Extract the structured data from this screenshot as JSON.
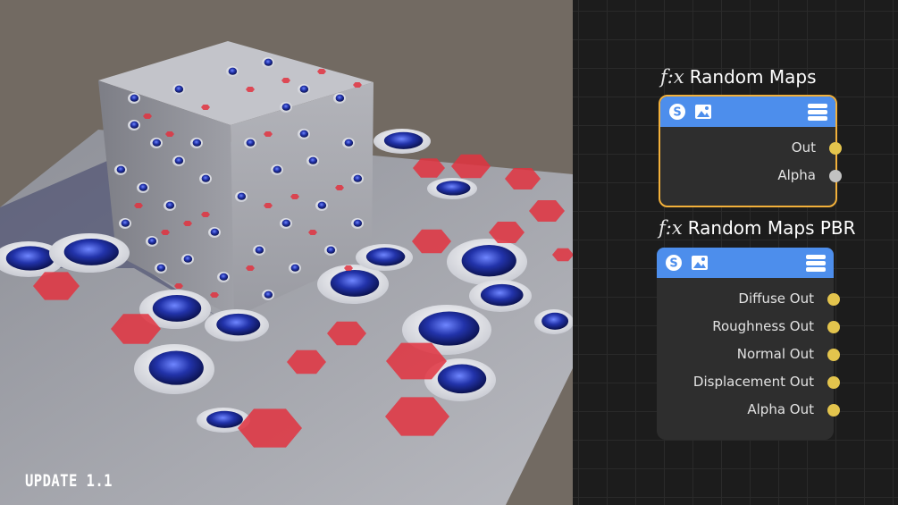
{
  "viewport": {
    "label": "UPDATE 1.1",
    "colors": {
      "background": "#726a62",
      "plane": "#a2a3a9",
      "cube": "#a9aab0",
      "red_spot": "#e23240",
      "blue_spot": "#1f2d9e"
    }
  },
  "node_editor": {
    "colors": {
      "background": "#1c1c1c",
      "header": "#4d8eec",
      "selected_border": "#f2b03a",
      "port_dot": "#e3c44d",
      "alpha_dot": "#c2c2c2"
    },
    "nodes": [
      {
        "prefix": "f:x",
        "title": "Random Maps",
        "selected": true,
        "header_icons": [
          "substance-icon",
          "image-icon",
          "menu-icon"
        ],
        "ports": [
          "Out",
          "Alpha"
        ]
      },
      {
        "prefix": "f:x",
        "title": "Random Maps PBR",
        "selected": false,
        "header_icons": [
          "substance-icon",
          "image-icon",
          "menu-icon"
        ],
        "ports": [
          "Diffuse Out",
          "Roughness Out",
          "Normal Out",
          "Displacement Out",
          "Alpha Out"
        ]
      }
    ]
  }
}
